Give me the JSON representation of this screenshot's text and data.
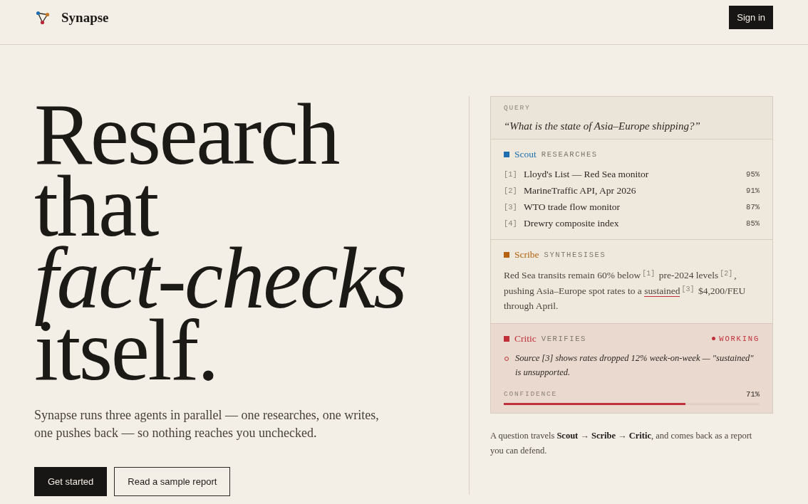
{
  "header": {
    "brand": "Synapse",
    "sign_in": "Sign in"
  },
  "hero": {
    "headline": "Research that *fact-checks* itself.",
    "description": "Synapse runs three agents in parallel — one researches, one writes, one pushes back — so nothing reaches you unchecked.",
    "buttons": [
      {
        "label": "Get started",
        "kind": "primary"
      },
      {
        "label": "Read a sample report",
        "kind": "secondary"
      }
    ]
  },
  "panel": {
    "query_label": "QUERY",
    "query": "“What is the state of Asia–Europe shipping?”",
    "agents": [
      {
        "kind": "sources",
        "name": "Scout",
        "role": "RESEARCHES",
        "color": "#1f6fae",
        "active": false,
        "sources": [
          {
            "ref": "[1]",
            "title": "Lloyd's List — Red Sea monitor",
            "score": "95%"
          },
          {
            "ref": "[2]",
            "title": "MarineTraffic API, Apr 2026",
            "score": "91%"
          },
          {
            "ref": "[3]",
            "title": "WTO trade flow monitor",
            "score": "87%"
          },
          {
            "ref": "[4]",
            "title": "Drewry composite index",
            "score": "85%"
          }
        ]
      },
      {
        "kind": "summary",
        "name": "Scribe",
        "role": "SYNTHESISES",
        "color": "#b3620f",
        "active": false,
        "segments": [
          {
            "text": "Red Sea transits remain 60% below$^{[1]}$ pre-2024 levels$^{[2]}$, pushing Asia–Europe spot rates to a ",
            "flagged": false
          },
          {
            "text": "sustained",
            "flagged": true
          },
          {
            "text": "$^{[3]}$ $4,200/FEU through April.",
            "flagged": false
          }
        ]
      },
      {
        "kind": "review",
        "name": "Critic",
        "role": "VERIFIES",
        "color": "#c0303a",
        "active": true,
        "status": "WORKING",
        "findings": [
          "Source [3] shows rates dropped 12% week-on-week — \"sustained\" is unsupported."
        ],
        "confidence": {
          "label": "CONFIDENCE",
          "reading": "71%",
          "level": 0.71
        }
      }
    ],
    "caption": "A question travels **Scout** → **Scribe** → **Critic**, and comes back as a report you can defend."
  }
}
